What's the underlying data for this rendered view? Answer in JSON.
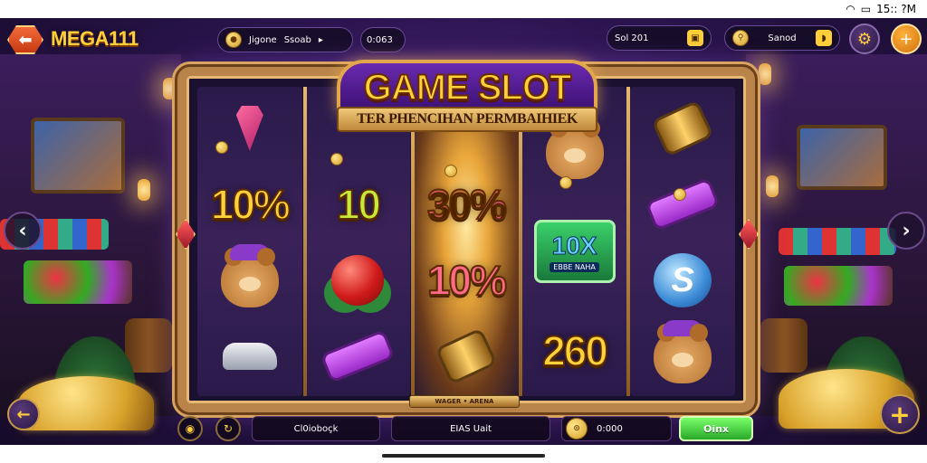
{
  "status_bar": {
    "time": "15:: ?M",
    "wifi_icon": "wifi-icon",
    "battery_icon": "battery-icon"
  },
  "header": {
    "brand": "MEGA111",
    "back_icon": "arrow-left-icon",
    "balance_pill": {
      "label": "Jigone",
      "value": "Ssoab",
      "extra": "0:063",
      "arrow": "▸"
    },
    "bet_pill": {
      "label": "Sol 201",
      "icon": "bag-icon"
    },
    "search_pill": {
      "label": "Sanod",
      "icon": "key-icon",
      "action_icon": "tag-icon"
    },
    "settings_icon": "gear-icon",
    "add_icon": "plus-icon"
  },
  "game": {
    "title": "GAME SLOT",
    "subtitle": "TER PHENCIHAN PERMBAIHIEK",
    "plate_text": "WAGER • ARENA",
    "reels": [
      {
        "cells": [
          {
            "kind": "gem"
          },
          {
            "kind": "text",
            "text": "10%",
            "color": "gold"
          },
          {
            "kind": "bear",
            "variant": "purple"
          },
          {
            "kind": "shoe"
          }
        ]
      },
      {
        "cells": [
          {
            "kind": "empty"
          },
          {
            "kind": "text",
            "text": "10",
            "color": "green"
          },
          {
            "kind": "apple"
          },
          {
            "kind": "cannon"
          }
        ]
      },
      {
        "cells": [
          {
            "kind": "empty"
          },
          {
            "kind": "text",
            "text": "30%",
            "color": "multi"
          },
          {
            "kind": "text",
            "text": "10%",
            "color": "pink"
          },
          {
            "kind": "barrel"
          }
        ]
      },
      {
        "cells": [
          {
            "kind": "bear",
            "variant": "red"
          },
          {
            "kind": "badge",
            "text": "10X",
            "sub": "EBBE NAHA"
          },
          {
            "kind": "text",
            "text": "260",
            "color": "gold"
          }
        ]
      },
      {
        "cells": [
          {
            "kind": "barrel"
          },
          {
            "kind": "cannon"
          },
          {
            "kind": "shield",
            "text": "S"
          },
          {
            "kind": "bear",
            "variant": "purple"
          }
        ]
      }
    ]
  },
  "nav": {
    "prev_icon": "chevron-left-icon",
    "next_icon": "chevron-right-icon"
  },
  "bottom_bar": {
    "corner_left_icon": "arrow-left-icon",
    "coin_btn_icon": "coin-icon",
    "refresh_icon": "refresh-icon",
    "field1": "Cl0ioboçk",
    "field2": "EIAS Uait",
    "credits_icon": "coin-icon",
    "credits": "0:000",
    "spin_label": "Oinx",
    "corner_right_icon": "plus-icon"
  },
  "colors": {
    "accent": "#ffcf3a",
    "frame": "#b8844a",
    "spin": "#2aa82a",
    "bg": "#2c1550"
  }
}
